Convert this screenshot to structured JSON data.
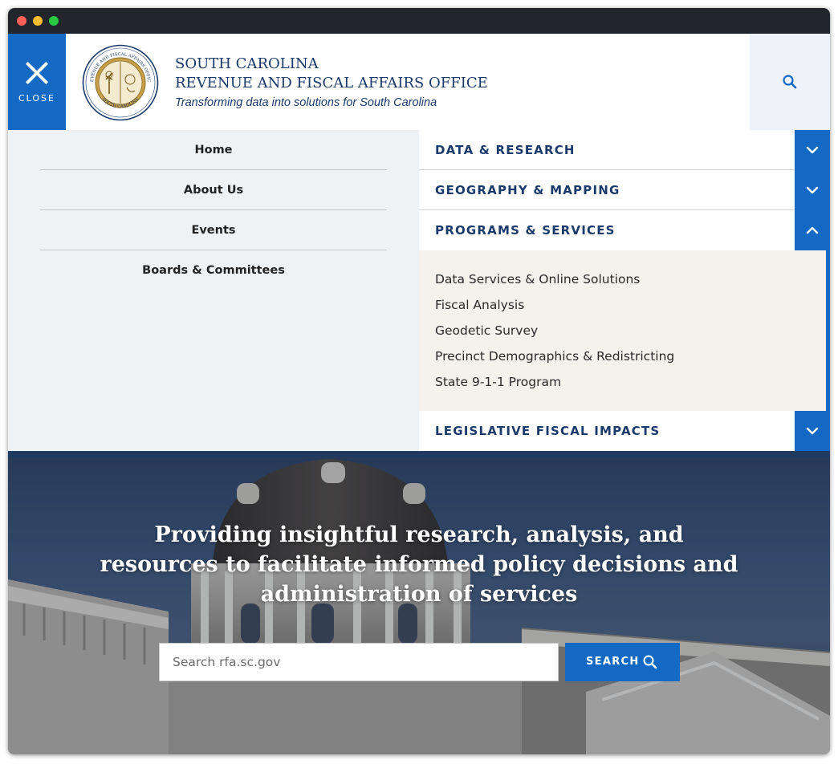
{
  "window": {
    "controls": [
      "close",
      "minimize",
      "zoom"
    ]
  },
  "header": {
    "close_label": "CLOSE",
    "org_line1": "SOUTH CAROLINA",
    "org_line2": "REVENUE AND FISCAL AFFAIRS OFFICE",
    "tagline": "Transforming data into solutions for South Carolina",
    "seal_text_top": "REVENUE AND FISCAL AFFAIRS OFFICE",
    "seal_text_bottom": "SOUTH CAROLINA",
    "search_icon": "search-icon"
  },
  "left_nav": {
    "items": [
      {
        "label": "Home"
      },
      {
        "label": "About Us"
      },
      {
        "label": "Events"
      },
      {
        "label": "Boards & Committees"
      }
    ]
  },
  "right_nav": {
    "sections": [
      {
        "label": "DATA & RESEARCH",
        "expanded": false,
        "icon": "chevron-down-icon"
      },
      {
        "label": "GEOGRAPHY & MAPPING",
        "expanded": false,
        "icon": "chevron-down-icon"
      },
      {
        "label": "PROGRAMS & SERVICES",
        "expanded": true,
        "icon": "chevron-up-icon",
        "items": [
          {
            "label": "Data Services & Online Solutions"
          },
          {
            "label": "Fiscal Analysis"
          },
          {
            "label": "Geodetic Survey"
          },
          {
            "label": "Precinct Demographics & Redistricting"
          },
          {
            "label": "State 9-1-1 Program"
          }
        ]
      },
      {
        "label": "LEGISLATIVE FISCAL IMPACTS",
        "expanded": false,
        "icon": "chevron-down-icon"
      }
    ]
  },
  "hero": {
    "title": "Providing insightful research, analysis, and resources to facilitate informed policy decisions and administration of services",
    "search_placeholder": "Search rfa.sc.gov",
    "search_value": "",
    "search_button": "SEARCH"
  },
  "colors": {
    "brand_blue": "#1369c3",
    "navy_text": "#1a3a6b",
    "menu_bg": "#eef2f5",
    "panel_bg": "#f5f2ec"
  }
}
